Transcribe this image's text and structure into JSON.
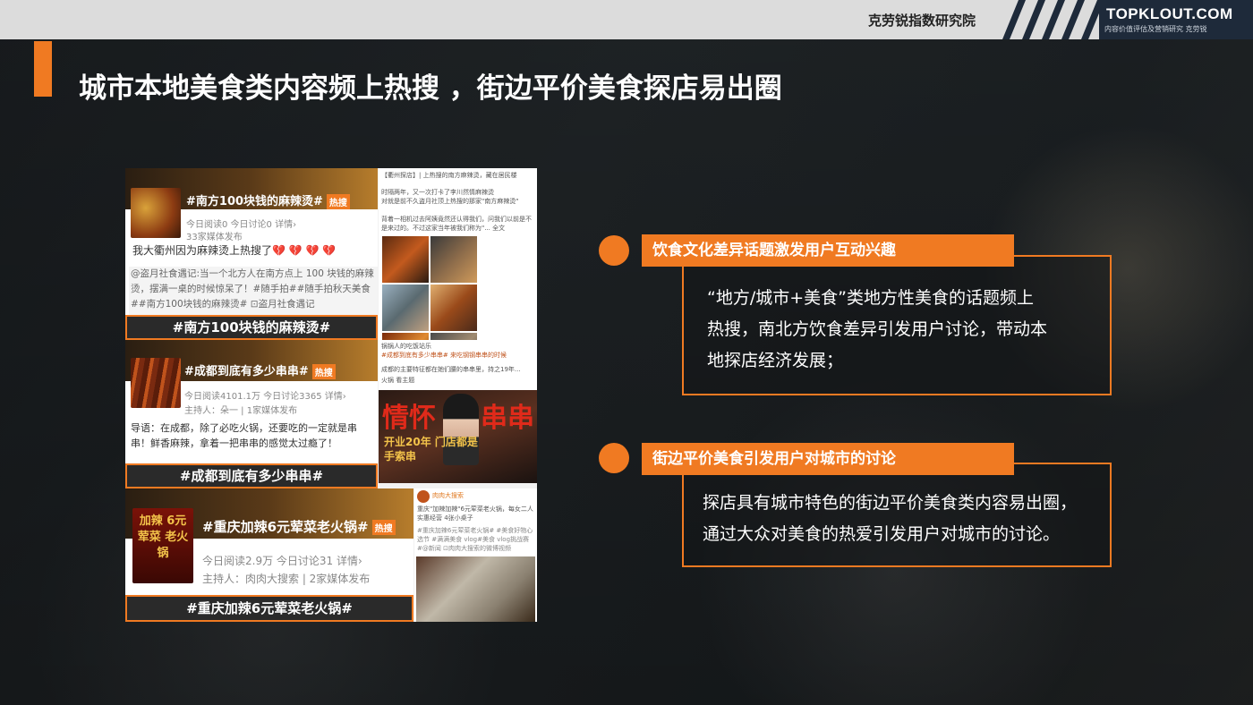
{
  "header": {
    "brand": "克劳锐指数研究院",
    "logo_main": "TOPKLOUT.COM",
    "logo_sub": "内容价值评估及营销研究 克劳锐"
  },
  "title": "城市本地美食类内容频上热搜 ，街边平价美食探店易出圈",
  "cards": [
    {
      "hashtag": "#南方100块钱的麻辣烫#",
      "hot": "热搜",
      "meta1": "今日阅读0  今日讨论0  详情›",
      "meta2": "33家媒体发布",
      "post": "我大衢州因为麻辣烫上热搜了💔 💔 💔 💔",
      "quote": "@盗月社食遇记:当一个北方人在南方点上 100 块钱的麻辣烫，摆满一桌的时候惊呆了！#随手拍##随手拍秋天美食##南方100块钱的麻辣烫#  ⊡盗月社食遇记",
      "caption": "#南方100块钱的麻辣烫#"
    },
    {
      "hashtag": "#成都到底有多少串串#",
      "hot": "热搜",
      "meta1": "今日阅读4101.1万  今日讨论3365  详情›",
      "meta2": "主持人：朵一 | 1家媒体发布",
      "post": "导语：在成都，除了必吃火锅，还要吃的一定就是串串！鲜香麻辣，拿着一把串串的感觉太过瘾了！",
      "caption": "#成都到底有多少串串#"
    },
    {
      "hashtag": "#重庆加辣6元荤菜老火锅#",
      "hot": "热搜",
      "meta1": "今日阅读2.9万  今日讨论31  详情›",
      "meta2": "主持人：肉肉大搜索 | 2家媒体发布",
      "thumb_text": "加辣 6元荤菜 老火锅",
      "caption": "#重庆加辣6元荤菜老火锅#"
    }
  ],
  "right_posts": {
    "p1_lines": [
      "【衢州探店】| 上热搜的南方麻辣烫，藏在居民楼",
      "时隔两年，又一次打卡了李川然情麻辣烫",
      "对就是前不久盗月社顶上热搜的那家\"南方麻辣烫\"",
      "背着一相机过去阿姨竟然还认得我们，问我们以前是不是来过的。不过这家当年被我们称为\"... 全文"
    ],
    "p2_lines": [
      "锅锅人的吃饭站乐",
      "#成都到底有多少串串# 来吃钢钢串串的时候",
      "成都的主要特征都在她们腰的串串里，持之19年...",
      "火锅 看主题"
    ],
    "banner_left": "情怀",
    "banner_right": "串串",
    "banner_sub": "开业20年 门店都是手索串",
    "p3_author": "肉肉大搜索",
    "p3_lines": [
      "重庆\"加辣加辣\"6元荤菜老火锅，每女二人实惠经营 4张小桌子",
      "#重庆加辣6元荤菜老火锅# #美食好物心选节 #满满美食 vlog#美食 vlog挑战赛 #@新闻 ⊡肉肉大搜索的微博视频"
    ]
  },
  "points": [
    {
      "title": "饮食文化差异话题激发用户互动兴趣",
      "lines": [
        "“地方/城市+美食”类地方性美食的话题频上",
        "热搜，南北方饮食差异引发用户讨论，带动本",
        "地探店经济发展；"
      ]
    },
    {
      "title": "街边平价美食引发用户对城市的讨论",
      "lines": [
        "探店具有城市特色的街边平价美食类内容易出圈，",
        "通过大众对美食的热爱引发用户对城市的讨论。"
      ]
    }
  ],
  "colors": {
    "accent": "#f07a22",
    "logo_bg": "#1e2a3a",
    "topbar": "#dcdcdc"
  }
}
